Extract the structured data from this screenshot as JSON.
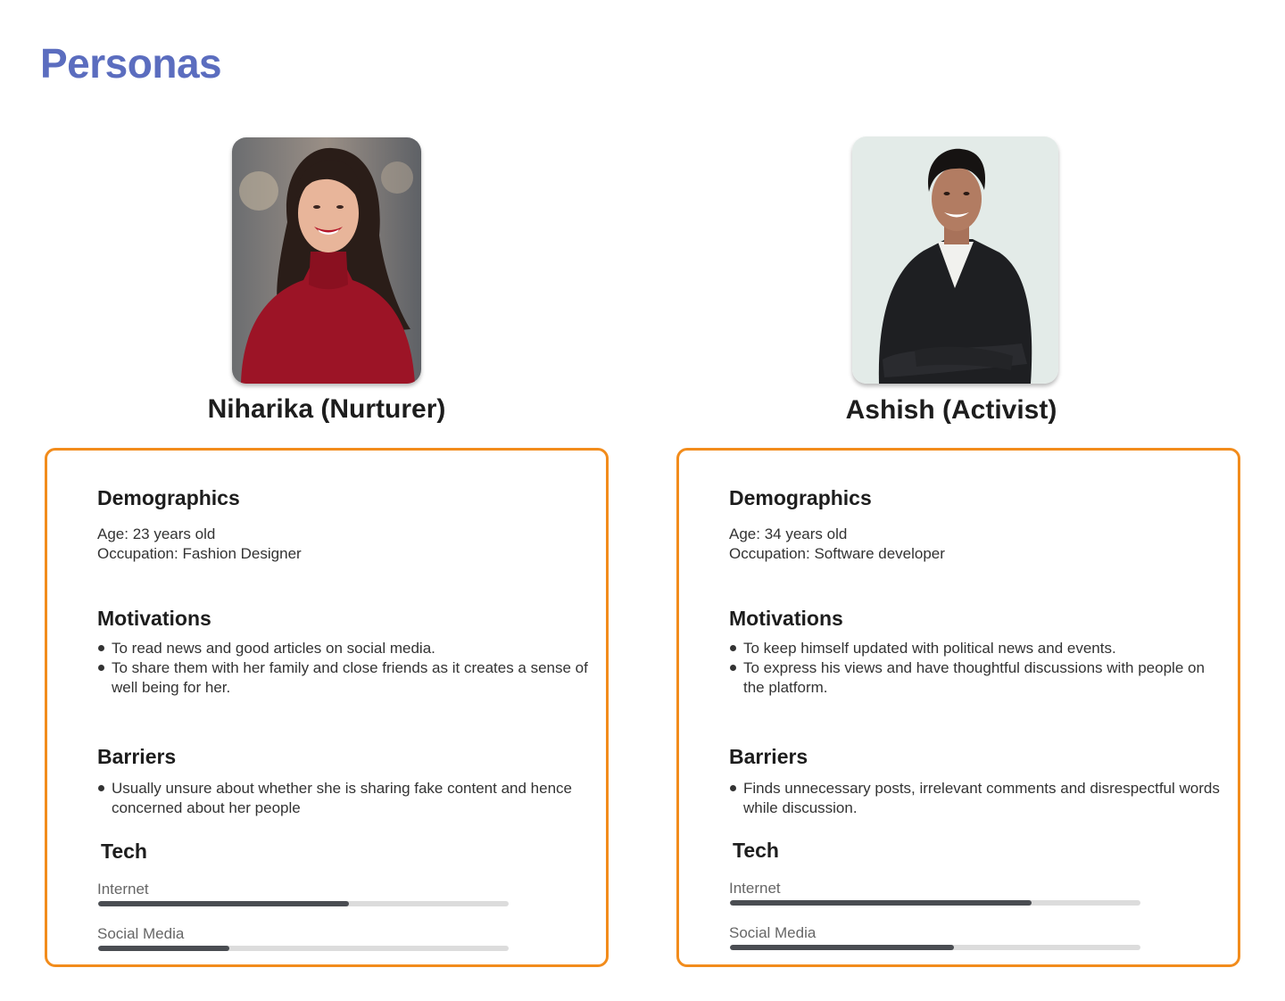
{
  "page": {
    "title": "Personas"
  },
  "colors": {
    "title": "#5b6dbf",
    "card_border": "#f28c1c",
    "bar_fill": "#4a4d52",
    "bar_track": "#dcdcdc"
  },
  "personas": [
    {
      "name": "Niharika (Nurturer)",
      "demographics": {
        "heading": "Demographics",
        "age": "Age: 23 years old",
        "occupation": "Occupation: Fashion Designer"
      },
      "motivations": {
        "heading": "Motivations",
        "items": [
          "To read news and good articles on social media.",
          "To share them with her family and close friends as it creates a sense of well being for her."
        ]
      },
      "barriers": {
        "heading": "Barriers",
        "items": [
          "Usually unsure about whether she is sharing fake content and hence concerned about her people"
        ]
      },
      "tech": {
        "heading": "Tech",
        "bars": [
          {
            "label": "Internet",
            "value": 0.61
          },
          {
            "label": "Social Media",
            "value": 0.32
          }
        ]
      }
    },
    {
      "name": "Ashish (Activist)",
      "demographics": {
        "heading": "Demographics",
        "age": "Age: 34 years old",
        "occupation": "Occupation: Software developer"
      },
      "motivations": {
        "heading": "Motivations",
        "items": [
          "To keep himself updated with political news and events.",
          "To express his views and have thoughtful discussions with people on the platform."
        ]
      },
      "barriers": {
        "heading": "Barriers",
        "items": [
          "Finds unnecessary posts, irrelevant comments and disrespectful words while discussion."
        ]
      },
      "tech": {
        "heading": "Tech",
        "bars": [
          {
            "label": "Internet",
            "value": 0.735
          },
          {
            "label": "Social Media",
            "value": 0.545
          }
        ]
      }
    }
  ]
}
